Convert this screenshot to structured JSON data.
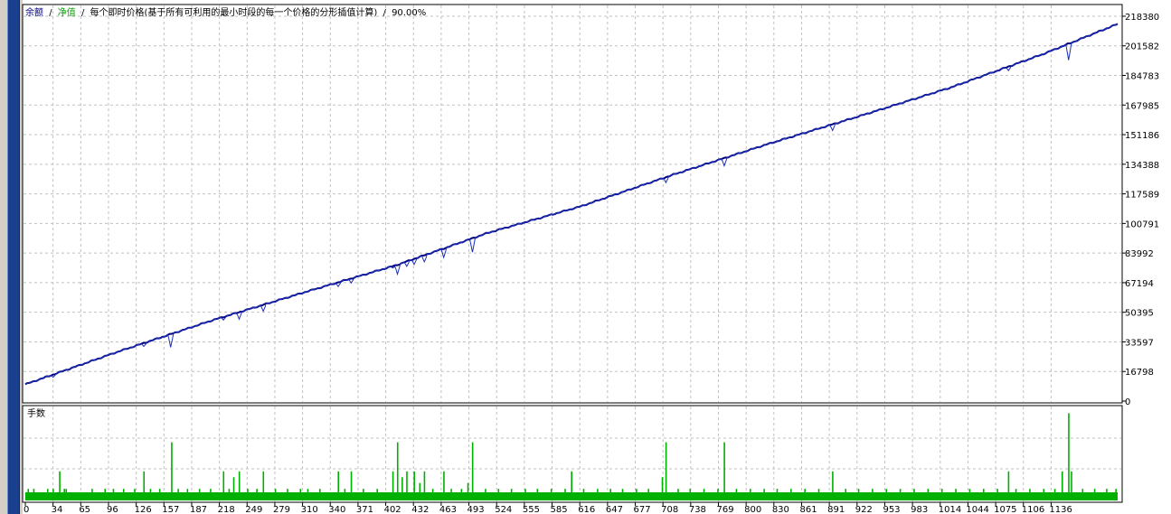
{
  "legend": {
    "balance_label": "余额",
    "equity_label": "净值",
    "separator": "/",
    "model_text": "每个即时价格(基于所有可利用的最小时段的每一个价格的分形插值计算)",
    "quality": "90.00%"
  },
  "colors": {
    "balance": "#000080",
    "equity": "#00c000",
    "volume": "#00b000",
    "grid": "#c0c0c0",
    "frame": "#000000",
    "left_strip": "#1b3f8f"
  },
  "chart_data": [
    {
      "type": "line",
      "series": [
        {
          "name": "余额",
          "color": "#000080"
        },
        {
          "name": "净值",
          "color": "#00c000"
        }
      ],
      "x": [
        0,
        100,
        200,
        300,
        400,
        500,
        600,
        700,
        800,
        900,
        1000,
        1100,
        1180
      ],
      "y": [
        9500,
        28000,
        45500,
        61500,
        77000,
        95500,
        110500,
        128500,
        145500,
        161500,
        178000,
        197000,
        214000
      ],
      "dips": [
        {
          "x": 30,
          "y": 13500
        },
        {
          "x": 128,
          "y": 31000
        },
        {
          "x": 157,
          "y": 30500
        },
        {
          "x": 214,
          "y": 46000
        },
        {
          "x": 231,
          "y": 46500
        },
        {
          "x": 257,
          "y": 51000
        },
        {
          "x": 338,
          "y": 65000
        },
        {
          "x": 352,
          "y": 67000
        },
        {
          "x": 397,
          "y": 75500
        },
        {
          "x": 402,
          "y": 72000
        },
        {
          "x": 412,
          "y": 76500
        },
        {
          "x": 420,
          "y": 77500
        },
        {
          "x": 431,
          "y": 79000
        },
        {
          "x": 452,
          "y": 81500
        },
        {
          "x": 483,
          "y": 84500
        },
        {
          "x": 590,
          "y": 108500
        },
        {
          "x": 692,
          "y": 124000
        },
        {
          "x": 755,
          "y": 133500
        },
        {
          "x": 872,
          "y": 153500
        },
        {
          "x": 1062,
          "y": 187500
        },
        {
          "x": 1127,
          "y": 193500
        }
      ],
      "ylim": [
        0,
        224000
      ],
      "yticks": [
        "218380",
        "201582",
        "184783",
        "167985",
        "151186",
        "134388",
        "117589",
        "100791",
        "83992",
        "67194",
        "50395",
        "33597",
        "16798",
        "0"
      ],
      "xticks": [
        "0",
        "34",
        "65",
        "96",
        "126",
        "157",
        "187",
        "218",
        "249",
        "279",
        "310",
        "340",
        "371",
        "402",
        "432",
        "463",
        "493",
        "524",
        "555",
        "585",
        "616",
        "647",
        "677",
        "708",
        "738",
        "769",
        "800",
        "830",
        "861",
        "891",
        "922",
        "953",
        "983",
        "1014",
        "1044",
        "1075",
        "1106",
        "1136"
      ],
      "grid": true,
      "legend": "top-left"
    },
    {
      "type": "bar",
      "title": "手数",
      "base_value": 1,
      "spikes": [
        {
          "x": 3,
          "v": 2
        },
        {
          "x": 9,
          "v": 2
        },
        {
          "x": 24,
          "v": 2
        },
        {
          "x": 30,
          "v": 2
        },
        {
          "x": 37,
          "v": 5
        },
        {
          "x": 42,
          "v": 2
        },
        {
          "x": 44,
          "v": 2
        },
        {
          "x": 72,
          "v": 2
        },
        {
          "x": 86,
          "v": 2
        },
        {
          "x": 95,
          "v": 2
        },
        {
          "x": 106,
          "v": 2
        },
        {
          "x": 118,
          "v": 2
        },
        {
          "x": 128,
          "v": 5
        },
        {
          "x": 135,
          "v": 2
        },
        {
          "x": 145,
          "v": 2
        },
        {
          "x": 158,
          "v": 10
        },
        {
          "x": 165,
          "v": 2
        },
        {
          "x": 175,
          "v": 2
        },
        {
          "x": 188,
          "v": 2
        },
        {
          "x": 200,
          "v": 2
        },
        {
          "x": 214,
          "v": 5
        },
        {
          "x": 220,
          "v": 2
        },
        {
          "x": 225,
          "v": 4
        },
        {
          "x": 231,
          "v": 5
        },
        {
          "x": 240,
          "v": 2
        },
        {
          "x": 250,
          "v": 2
        },
        {
          "x": 257,
          "v": 5
        },
        {
          "x": 270,
          "v": 2
        },
        {
          "x": 283,
          "v": 2
        },
        {
          "x": 297,
          "v": 2
        },
        {
          "x": 305,
          "v": 2
        },
        {
          "x": 318,
          "v": 2
        },
        {
          "x": 338,
          "v": 5
        },
        {
          "x": 345,
          "v": 2
        },
        {
          "x": 352,
          "v": 5
        },
        {
          "x": 365,
          "v": 2
        },
        {
          "x": 380,
          "v": 2
        },
        {
          "x": 397,
          "v": 5
        },
        {
          "x": 402,
          "v": 10
        },
        {
          "x": 407,
          "v": 4
        },
        {
          "x": 412,
          "v": 5
        },
        {
          "x": 420,
          "v": 5
        },
        {
          "x": 426,
          "v": 3
        },
        {
          "x": 431,
          "v": 5
        },
        {
          "x": 440,
          "v": 2
        },
        {
          "x": 452,
          "v": 5
        },
        {
          "x": 460,
          "v": 2
        },
        {
          "x": 471,
          "v": 2
        },
        {
          "x": 478,
          "v": 3
        },
        {
          "x": 483,
          "v": 10
        },
        {
          "x": 497,
          "v": 2
        },
        {
          "x": 511,
          "v": 2
        },
        {
          "x": 525,
          "v": 2
        },
        {
          "x": 540,
          "v": 2
        },
        {
          "x": 553,
          "v": 2
        },
        {
          "x": 568,
          "v": 2
        },
        {
          "x": 583,
          "v": 2
        },
        {
          "x": 590,
          "v": 5
        },
        {
          "x": 603,
          "v": 2
        },
        {
          "x": 618,
          "v": 2
        },
        {
          "x": 632,
          "v": 2
        },
        {
          "x": 645,
          "v": 2
        },
        {
          "x": 660,
          "v": 2
        },
        {
          "x": 673,
          "v": 2
        },
        {
          "x": 688,
          "v": 4
        },
        {
          "x": 692,
          "v": 10
        },
        {
          "x": 705,
          "v": 2
        },
        {
          "x": 718,
          "v": 2
        },
        {
          "x": 733,
          "v": 2
        },
        {
          "x": 748,
          "v": 2
        },
        {
          "x": 755,
          "v": 10
        },
        {
          "x": 768,
          "v": 2
        },
        {
          "x": 783,
          "v": 2
        },
        {
          "x": 798,
          "v": 2
        },
        {
          "x": 812,
          "v": 2
        },
        {
          "x": 827,
          "v": 2
        },
        {
          "x": 842,
          "v": 2
        },
        {
          "x": 857,
          "v": 2
        },
        {
          "x": 872,
          "v": 5
        },
        {
          "x": 886,
          "v": 2
        },
        {
          "x": 900,
          "v": 2
        },
        {
          "x": 915,
          "v": 2
        },
        {
          "x": 930,
          "v": 2
        },
        {
          "x": 945,
          "v": 2
        },
        {
          "x": 960,
          "v": 2
        },
        {
          "x": 975,
          "v": 2
        },
        {
          "x": 990,
          "v": 2
        },
        {
          "x": 1005,
          "v": 2
        },
        {
          "x": 1020,
          "v": 2
        },
        {
          "x": 1035,
          "v": 2
        },
        {
          "x": 1050,
          "v": 2
        },
        {
          "x": 1062,
          "v": 5
        },
        {
          "x": 1070,
          "v": 2
        },
        {
          "x": 1085,
          "v": 2
        },
        {
          "x": 1100,
          "v": 2
        },
        {
          "x": 1112,
          "v": 2
        },
        {
          "x": 1120,
          "v": 5
        },
        {
          "x": 1127,
          "v": 15
        },
        {
          "x": 1130,
          "v": 5
        },
        {
          "x": 1142,
          "v": 2
        },
        {
          "x": 1155,
          "v": 2
        },
        {
          "x": 1168,
          "v": 2
        },
        {
          "x": 1178,
          "v": 2
        }
      ],
      "ylim": [
        0,
        16
      ]
    }
  ]
}
